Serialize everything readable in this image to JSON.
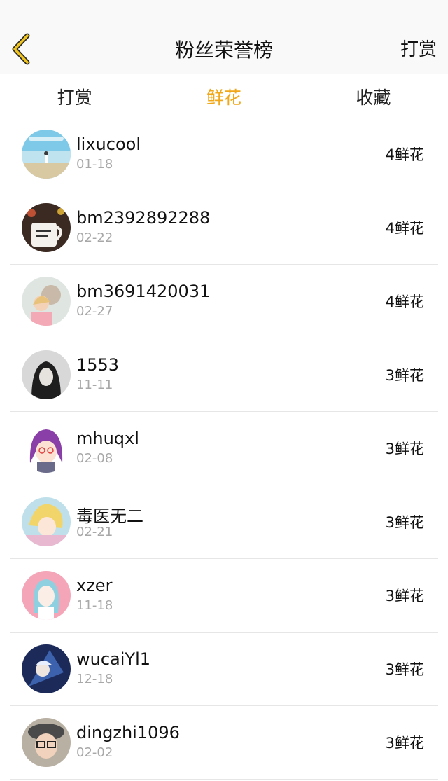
{
  "header": {
    "title": "粉丝荣誉榜",
    "right_action": "打赏",
    "back_icon": "chevron-left-icon",
    "accent_color": "#f0a81a"
  },
  "tabs": [
    {
      "label": "打赏",
      "active": false
    },
    {
      "label": "鲜花",
      "active": true
    },
    {
      "label": "收藏",
      "active": false
    }
  ],
  "fans": [
    {
      "name": "lixucool",
      "date": "01-18",
      "count": "4鲜花"
    },
    {
      "name": "bm2392892288",
      "date": "02-22",
      "count": "4鲜花"
    },
    {
      "name": "bm3691420031",
      "date": "02-27",
      "count": "4鲜花"
    },
    {
      "name": "1553",
      "date": "11-11",
      "count": "3鲜花"
    },
    {
      "name": "mhuqxl",
      "date": "02-08",
      "count": "3鲜花"
    },
    {
      "name": "毒医无二",
      "date": "02-21",
      "count": "3鲜花"
    },
    {
      "name": "xzer",
      "date": "11-18",
      "count": "3鲜花"
    },
    {
      "name": "wucaiYl1",
      "date": "12-18",
      "count": "3鲜花"
    },
    {
      "name": "dingzhi1096",
      "date": "02-02",
      "count": "3鲜花"
    }
  ]
}
